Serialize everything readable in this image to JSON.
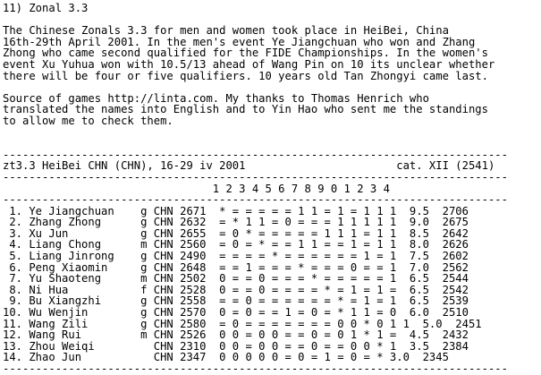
{
  "heading": "11) Zonal 3.3",
  "intro": [
    "The Chinese Zonals 3.3 for men and women took place in HeiBei, China",
    "16th-29th April 2001. In the men's event Ye Jiangchuan who won and Zhang",
    "Zhong who came second qualified for the FIDE Championships. In the women's",
    "event Xu Yuhua won with 10.5/13 ahead of Wang Pin on 10 its unclear whether",
    "there will be four or five qualifiers. 10 years old Tan Zhongyi came last."
  ],
  "source": [
    "Source of games http://linta.com. My thanks to Thomas Henrich who",
    "translated the names into English and to Yin Hao who sent me the standings",
    "to allow me to check them."
  ],
  "table": {
    "rule": "-----------------------------------------------------------------------------",
    "title_line": "zt3.3 HeiBei CHN (CHN), 16-29 iv 2001                       cat. XII (2541)",
    "columns_line": "                                1 2 3 4 5 6 7 8 9 0 1 2 3 4",
    "rows": [
      " 1. Ye Jiangchuan    g CHN 2671  * = = = = = 1 1 = 1 = 1 1 1  9.5  2706",
      " 2. Zhang Zhong      g CHN 2632  = * 1 1 = 0 = = = 1 1 1 1 1  9.0  2675",
      " 3. Xu Jun           g CHN 2655  = 0 * = = = = = 1 1 1 = 1 1  8.5  2642",
      " 4. Liang Chong      m CHN 2560  = 0 = * = = 1 1 = = 1 = 1 1  8.0  2626",
      " 5. Liang Jinrong    g CHN 2490  = = = = * = = = = = = 1 = 1  7.5  2602",
      " 6. Peng Xiaomin     g CHN 2648  = = 1 = = = * = = = 0 = = 1  7.0  2562",
      " 7. Yu Shaoteng      m CHN 2502  0 = = 0 = = = * = = = = = 1  6.5  2544",
      " 8. Ni Hua           f CHN 2528  0 = = 0 = = = = * = 1 = 1 =  6.5  2542",
      " 9. Bu Xiangzhi      g CHN 2558  = = 0 = = = = = = * = 1 = 1  6.5  2539",
      "10. Wu Wenjin        g CHN 2570  0 = 0 = = 1 = 0 = * 1 1 = 0  6.0  2510",
      "11. Wang Zili        g CHN 2580  = 0 = = = = = = = 0 0 * 0 1 1  5.0  2451",
      "12. Wang Rui         m CHN 2526  0 0 = 0 0 = = 0 = 0 1 * 1 =  4.5  2432",
      "13. Zhou Weiqi         CHN 2310  0 0 = 0 0 = = 0 = = 0 0 * 1  3.5  2384",
      "14. Zhao Jun           CHN 2347  0 0 0 0 0 = 0 = 1 = 0 = * 3.0  2345"
    ],
    "bottom_rule": "-----------------------------------------------------------------------------"
  }
}
